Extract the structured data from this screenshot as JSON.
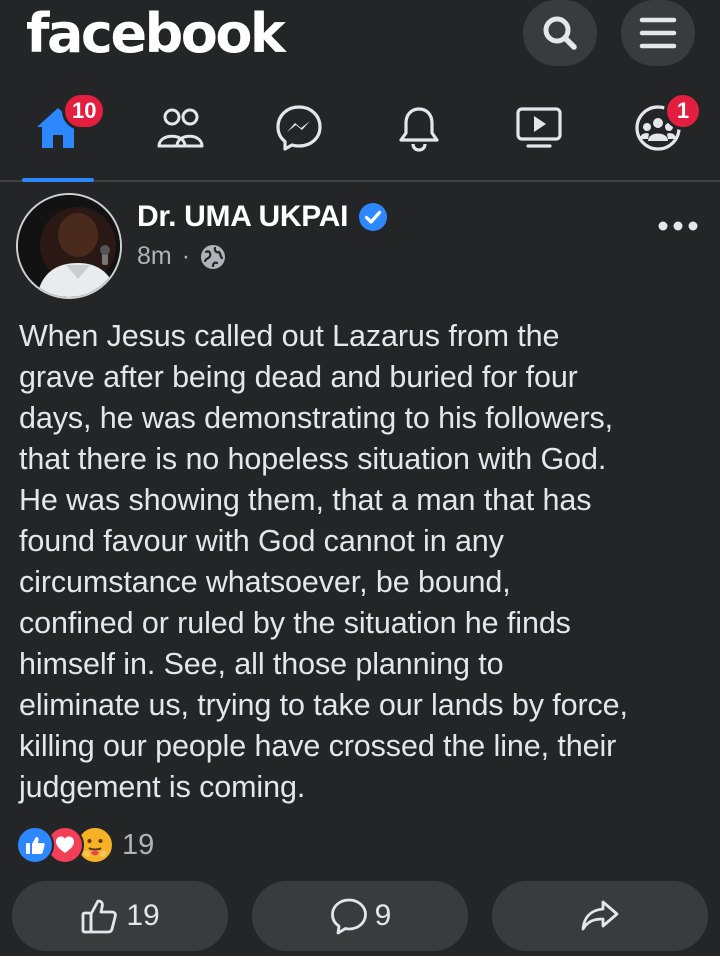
{
  "app": {
    "logo": "facebook"
  },
  "topbar": {
    "search_icon": "search-icon",
    "menu_icon": "menu-icon"
  },
  "nav": {
    "tabs": [
      {
        "name": "home",
        "icon": "home-icon",
        "active": true,
        "badge": "10"
      },
      {
        "name": "friends",
        "icon": "friends-icon",
        "active": false
      },
      {
        "name": "messenger",
        "icon": "messenger-icon",
        "active": false
      },
      {
        "name": "notifications",
        "icon": "bell-icon",
        "active": false
      },
      {
        "name": "watch",
        "icon": "video-icon",
        "active": false
      },
      {
        "name": "groups",
        "icon": "groups-icon",
        "active": false,
        "badge": "1"
      }
    ]
  },
  "post": {
    "author": "Dr. UMA UKPAI",
    "verified": true,
    "time": "8m",
    "separator": "·",
    "audience_icon": "globe-icon",
    "text": "When Jesus called out Lazarus from the\ngrave after being dead and buried for four\ndays, he was demonstrating to his followers,\nthat there is no hopeless situation with God.\nHe was showing them, that a man that has\nfound favour with God cannot in any\ncircumstance whatsoever, be bound,\nconfined or ruled by the situation he finds\nhimself in. See, all those planning  to\neliminate us, trying to take our lands by force,\nkilling our people have crossed the line, their\njudgement is coming.",
    "reactions": {
      "types": [
        "like",
        "love",
        "care"
      ],
      "count": "19"
    },
    "actions": {
      "like_count": "19",
      "comment_count": "9"
    }
  },
  "colors": {
    "background": "#242526",
    "accent": "#2d88ff",
    "badge": "#e41e3f",
    "button": "#3a3b3c"
  }
}
